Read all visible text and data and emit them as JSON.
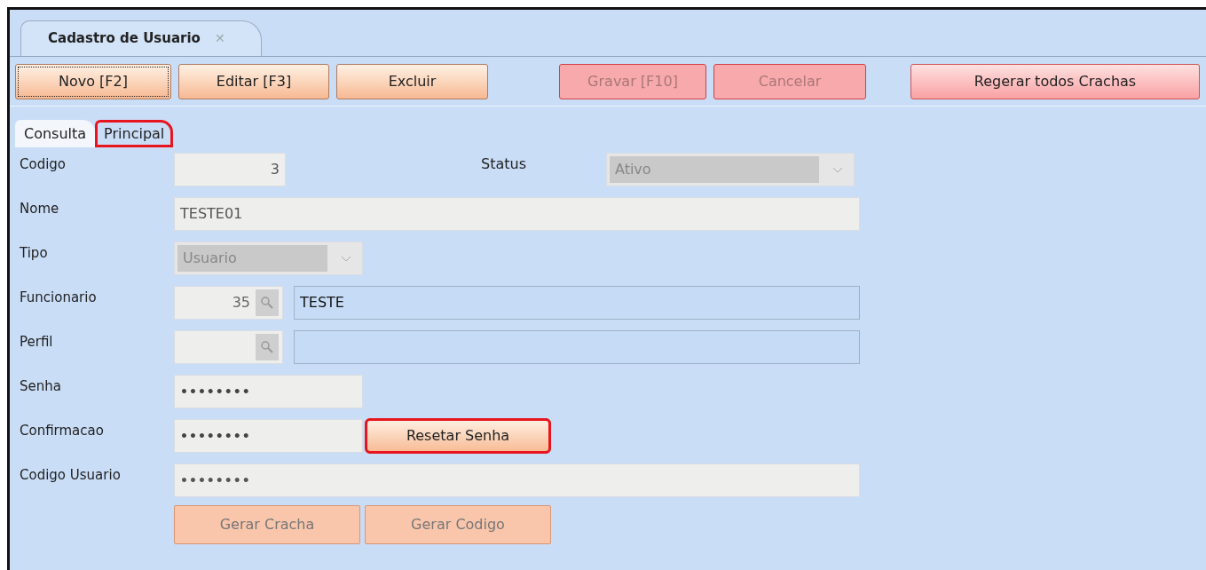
{
  "document_tab": {
    "title": "Cadastro de Usuario",
    "close": "✕"
  },
  "toolbar": [
    {
      "label": "Novo [F2]",
      "disabled": false,
      "focused": true
    },
    {
      "label": "Editar [F3]",
      "disabled": false,
      "focused": false
    },
    {
      "label": "Excluir",
      "disabled": false,
      "focused": false
    },
    {
      "label": "Gravar [F10]",
      "disabled": true,
      "focused": false
    },
    {
      "label": "Cancelar",
      "disabled": true,
      "focused": false
    },
    {
      "label": "Regerar todos Crachas",
      "disabled": false,
      "focused": false
    }
  ],
  "tabs": [
    {
      "label": "Consulta",
      "selected": false,
      "highlighted": false
    },
    {
      "label": "Principal",
      "selected": true,
      "highlighted": true
    }
  ],
  "form": [
    {
      "label": "Codigo",
      "fields": [
        {
          "kind": "number",
          "value": "3"
        },
        {
          "kind": "label",
          "value": "Status"
        },
        {
          "kind": "select",
          "value": "Ativo"
        }
      ]
    },
    {
      "label": "Nome",
      "fields": [
        {
          "kind": "text",
          "value": "TESTE01"
        }
      ]
    },
    {
      "label": "Tipo",
      "fields": [
        {
          "kind": "select",
          "value": "Usuario"
        }
      ]
    },
    {
      "label": "Funcionario",
      "fields": [
        {
          "kind": "lookup",
          "value": "35"
        },
        {
          "kind": "readonly",
          "value": "TESTE"
        }
      ]
    },
    {
      "label": "Perfil",
      "fields": [
        {
          "kind": "lookup"
        },
        {
          "kind": "readonly"
        }
      ]
    },
    {
      "label": "Senha",
      "fields": [
        {
          "kind": "password",
          "value": "••••••••"
        }
      ]
    },
    {
      "label": "Confirmacao",
      "fields": [
        {
          "kind": "password",
          "value": "••••••••"
        },
        {
          "kind": "button",
          "value": "Resetar Senha",
          "highlighted": true
        }
      ]
    },
    {
      "label": "Codigo Usuario",
      "fields": [
        {
          "kind": "password",
          "value": "••••••••"
        }
      ]
    }
  ],
  "bottom_buttons": [
    {
      "label": "Gerar Cracha",
      "disabled": true
    },
    {
      "label": "Gerar Codigo",
      "disabled": true
    }
  ]
}
